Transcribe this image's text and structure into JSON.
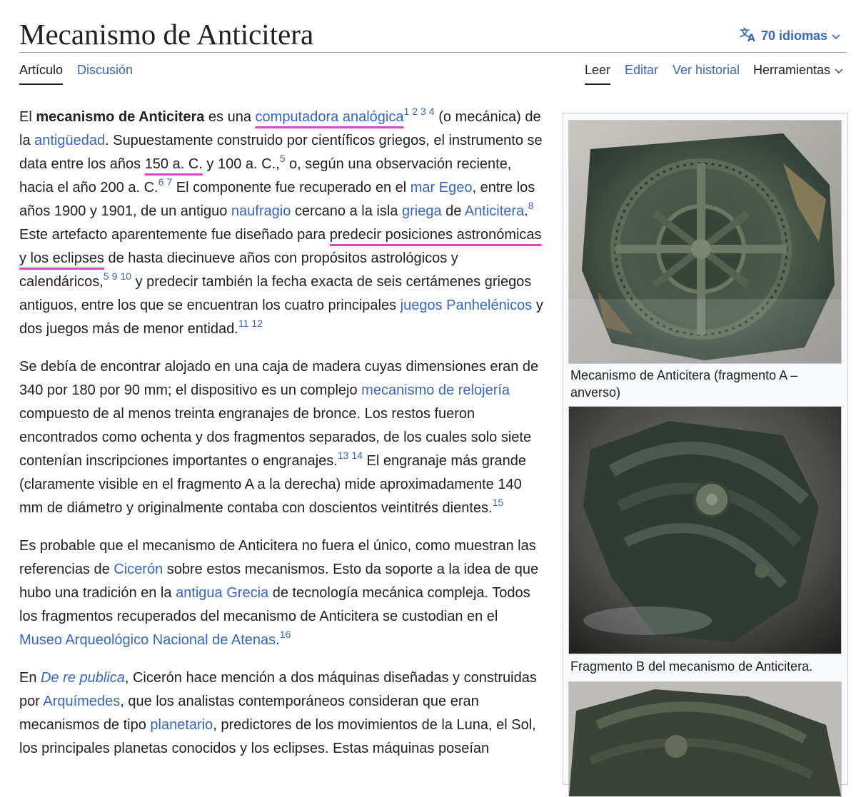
{
  "page": {
    "title": "Mecanismo de Anticitera",
    "languages": "70 idiomas",
    "tabs_left": [
      "Artículo",
      "Discusión"
    ],
    "tabs_right": [
      "Leer",
      "Editar",
      "Ver historial",
      "Herramientas"
    ]
  },
  "colors": {
    "link": "#3366cc",
    "text": "#202122",
    "highlight_underline": "#e042d2",
    "infobox_bg": "#f8f9fa",
    "infobox_border": "#c8ccd1"
  },
  "icons": {
    "language": "translate-icon",
    "dropdown": "chevron-down-icon"
  },
  "article": {
    "p1": {
      "t1": "El ",
      "b1": "mecanismo de Anticitera",
      "t2": " es una ",
      "l1": "computadora analógica",
      "r1": [
        "1",
        "2",
        "3",
        "4"
      ],
      "t3": " (o mecánica) de la ",
      "l2": "antigüedad",
      "t4": ". Supuestamente construido por científicos griegos, el instrumento se data entre los años ",
      "u1": "150 a. C.",
      "t5": " y 100 a. C.,",
      "r2": [
        "5"
      ],
      "t6": " o, según una observación reciente, hacia el año 200 a. C.",
      "r3": [
        "6",
        "7"
      ],
      "t7": " El componente fue recuperado en el ",
      "l3": "mar Egeo",
      "t8": ", entre los años 1900 y 1901, de un antiguo ",
      "l4": "naufragio",
      "t9": " cercano a la isla ",
      "l5": "griega",
      "t10": " de ",
      "l6": "Anticitera",
      "t11": ".",
      "r4": [
        "8"
      ],
      "t12": " Este artefacto aparentemente fue diseñado para ",
      "u2": "predecir posiciones astronómicas y los eclipses",
      "t13": " de hasta diecinueve años con propósitos astrológicos y calendáricos,",
      "r5": [
        "5",
        "9",
        "10"
      ],
      "t14": " y predecir también la fecha exacta de seis certámenes griegos antiguos, entre los que se encuentran los cuatro principales ",
      "l7": "juegos Panhelénicos",
      "t15": " y dos juegos más de menor entidad.",
      "r6": [
        "11",
        "12"
      ]
    },
    "p2": {
      "t1": "Se debía de encontrar alojado en una caja de madera cuyas dimensiones eran de 340 por 180 por 90 mm; el dispositivo es un complejo ",
      "l1": "mecanismo de relojería",
      "t2": " compuesto de al menos treinta engranajes de bronce. Los restos fueron encontrados como ochenta y dos fragmentos separados, de los cuales solo siete contenían inscripciones importantes o engranajes.",
      "r1": [
        "13",
        "14"
      ],
      "t3": " El engranaje más grande (claramente visible en el fragmento A a la derecha) mide aproximadamente 140 mm de diámetro y originalmente contaba con doscientos veintitrés dientes.",
      "r2": [
        "15"
      ]
    },
    "p3": {
      "t1": "Es probable que el mecanismo de Anticitera no fuera el único, como muestran las referencias de ",
      "l1": "Cicerón",
      "t2": " sobre estos mecanismos. Esto da soporte a la idea de que hubo una tradición en la ",
      "l2": "antigua Grecia",
      "t3": " de tecnología mecánica compleja. Todos los fragmentos recuperados del mecanismo de Anticitera se custodian en el ",
      "l3": "Museo Arqueológico Nacional de Atenas",
      "t4": ".",
      "r1": [
        "16"
      ]
    },
    "p4": {
      "t1": "En ",
      "l1": "De re publica",
      "t2": ", Cicerón hace mención a dos máquinas diseñadas y construidas por ",
      "l2": "Arquímedes",
      "t3": ", que los analistas contemporáneos consideran que eran mecanismos de tipo ",
      "l3": "planetario",
      "t4": ", predictores de los movimientos de la Luna, el Sol, los principales planetas conocidos y los eclipses. Estas máquinas poseían"
    }
  },
  "infobox": {
    "caption_a": "Mecanismo de Anticitera (fragmento A – anverso)",
    "caption_b": "Fragmento B del mecanismo de Anticitera."
  }
}
